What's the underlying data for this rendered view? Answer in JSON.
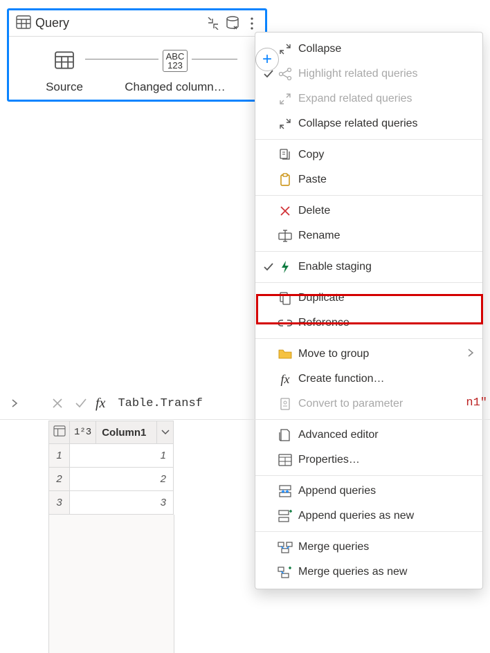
{
  "query_card": {
    "title": "Query",
    "steps": [
      {
        "label": "Source",
        "icon": "table"
      },
      {
        "label": "Changed column…",
        "icon": "abc123"
      }
    ]
  },
  "context_menu": {
    "items": [
      {
        "id": "collapse",
        "label": "Collapse",
        "icon": "collapse",
        "checked": false,
        "disabled": false
      },
      {
        "id": "highlight-related",
        "label": "Highlight related queries",
        "icon": "share",
        "checked": true,
        "disabled": true
      },
      {
        "id": "expand-related",
        "label": "Expand related queries",
        "icon": "expand",
        "checked": false,
        "disabled": true
      },
      {
        "id": "collapse-related",
        "label": "Collapse related queries",
        "icon": "collapse",
        "checked": false,
        "disabled": false
      },
      {
        "sep": true
      },
      {
        "id": "copy",
        "label": "Copy",
        "icon": "copy",
        "checked": false,
        "disabled": false
      },
      {
        "id": "paste",
        "label": "Paste",
        "icon": "paste",
        "checked": false,
        "disabled": false
      },
      {
        "sep": true
      },
      {
        "id": "delete",
        "label": "Delete",
        "icon": "delete",
        "checked": false,
        "disabled": false
      },
      {
        "id": "rename",
        "label": "Rename",
        "icon": "rename",
        "checked": false,
        "disabled": false
      },
      {
        "sep": true
      },
      {
        "id": "enable-staging",
        "label": "Enable staging",
        "icon": "bolt",
        "checked": true,
        "disabled": false,
        "highlight": true
      },
      {
        "sep": true
      },
      {
        "id": "duplicate",
        "label": "Duplicate",
        "icon": "duplicate",
        "checked": false,
        "disabled": false
      },
      {
        "id": "reference",
        "label": "Reference",
        "icon": "reference",
        "checked": false,
        "disabled": false
      },
      {
        "sep": true
      },
      {
        "id": "move-to-group",
        "label": "Move to group",
        "icon": "folder",
        "checked": false,
        "disabled": false,
        "submenu": true
      },
      {
        "id": "create-function",
        "label": "Create function…",
        "icon": "fx",
        "checked": false,
        "disabled": false
      },
      {
        "id": "convert-parameter",
        "label": "Convert to parameter",
        "icon": "parameter",
        "checked": false,
        "disabled": true
      },
      {
        "sep": true
      },
      {
        "id": "advanced-editor",
        "label": "Advanced editor",
        "icon": "editor",
        "checked": false,
        "disabled": false
      },
      {
        "id": "properties",
        "label": "Properties…",
        "icon": "properties",
        "checked": false,
        "disabled": false
      },
      {
        "sep": true
      },
      {
        "id": "append",
        "label": "Append queries",
        "icon": "append",
        "checked": false,
        "disabled": false
      },
      {
        "id": "append-new",
        "label": "Append queries as new",
        "icon": "append-new",
        "checked": false,
        "disabled": false
      },
      {
        "sep": true
      },
      {
        "id": "merge",
        "label": "Merge queries",
        "icon": "merge",
        "checked": false,
        "disabled": false
      },
      {
        "id": "merge-new",
        "label": "Merge queries as new",
        "icon": "merge-new",
        "checked": false,
        "disabled": false
      }
    ]
  },
  "formula_bar": {
    "fx_label": "fx",
    "text": "Table.Transf",
    "tail": "n1\""
  },
  "table": {
    "column": {
      "type_prefix": "1²3",
      "name": "Column1"
    },
    "rows": [
      {
        "num": "1",
        "val": "1"
      },
      {
        "num": "2",
        "val": "2"
      },
      {
        "num": "3",
        "val": "3"
      }
    ]
  }
}
